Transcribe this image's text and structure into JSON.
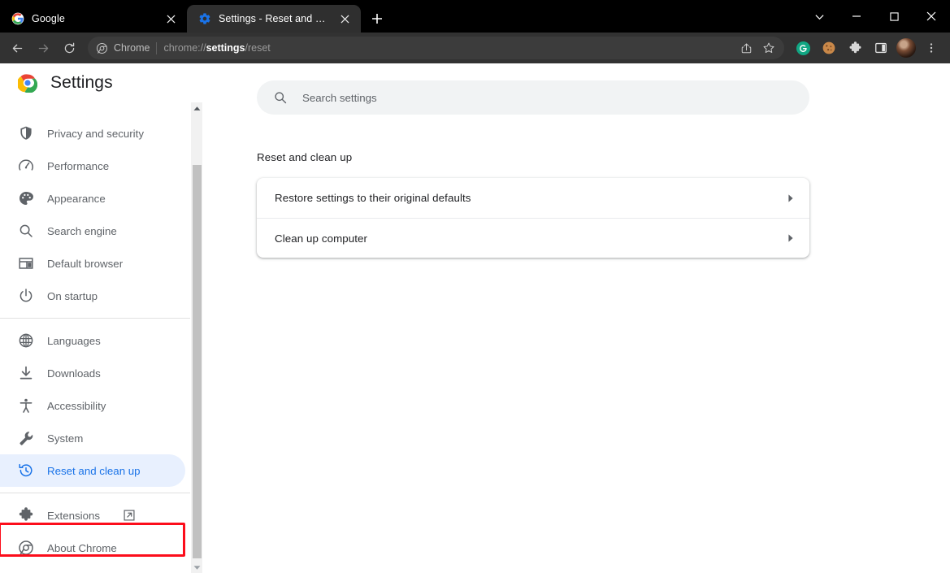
{
  "window": {
    "controls": [
      {
        "name": "tab-search-button",
        "icon": "chevron-down-icon",
        "label": "Search tabs"
      },
      {
        "name": "minimize-button",
        "icon": "minimize-icon",
        "label": "Minimize"
      },
      {
        "name": "maximize-button",
        "icon": "maximize-icon",
        "label": "Maximize"
      },
      {
        "name": "close-window-button",
        "icon": "close-icon",
        "label": "Close"
      }
    ]
  },
  "tabs": [
    {
      "title": "Google",
      "favicon": "google-favicon",
      "active": false,
      "close_label": "Close tab"
    },
    {
      "title": "Settings - Reset and clean up",
      "favicon": "settings-gear-favicon",
      "active": true,
      "close_label": "Close tab"
    }
  ],
  "new_tab_label": "New tab",
  "toolbar": {
    "back_label": "Back",
    "forward_label": "Forward",
    "reload_label": "Reload",
    "omnibox": {
      "chip_label": "Chrome",
      "url_prefix": "chrome://",
      "url_bold": "settings",
      "url_suffix": "/reset",
      "share_label": "Share this page",
      "bookmark_label": "Bookmark this tab"
    },
    "actions": [
      {
        "name": "grammarly-extension-icon",
        "label": "Grammarly",
        "color": "#11a683"
      },
      {
        "name": "cookie-extension-icon",
        "label": "Cookie manager",
        "color": "#c98849"
      },
      {
        "name": "extensions-icon",
        "label": "Extensions",
        "color": "#d7d7d7"
      },
      {
        "name": "side-panel-icon",
        "label": "Side panel",
        "color": "#e4e4e4"
      },
      {
        "name": "profile-avatar",
        "label": "Profile",
        "color": "#7a4d35"
      },
      {
        "name": "chrome-menu-icon",
        "label": "Customize and control Google Chrome",
        "color": "#d7d7d7"
      }
    ]
  },
  "settings": {
    "title": "Settings",
    "logo": "chrome-logo",
    "search": {
      "placeholder": "Search settings",
      "icon": "search-icon"
    },
    "nav_groups": [
      {
        "items": [
          {
            "label": "Privacy and security",
            "icon": "shield-icon",
            "selected": false
          },
          {
            "label": "Performance",
            "icon": "speedometer-icon",
            "selected": false
          },
          {
            "label": "Appearance",
            "icon": "palette-icon",
            "selected": false
          },
          {
            "label": "Search engine",
            "icon": "search-icon",
            "selected": false
          },
          {
            "label": "Default browser",
            "icon": "browser-window-icon",
            "selected": false
          },
          {
            "label": "On startup",
            "icon": "power-icon",
            "selected": false
          }
        ]
      },
      {
        "items": [
          {
            "label": "Languages",
            "icon": "globe-icon",
            "selected": false
          },
          {
            "label": "Downloads",
            "icon": "download-icon",
            "selected": false
          },
          {
            "label": "Accessibility",
            "icon": "accessibility-icon",
            "selected": false
          },
          {
            "label": "System",
            "icon": "wrench-icon",
            "selected": false
          },
          {
            "label": "Reset and clean up",
            "icon": "history-restore-icon",
            "selected": true
          }
        ]
      },
      {
        "items": [
          {
            "label": "Extensions",
            "icon": "puzzle-icon",
            "selected": false,
            "external": true
          },
          {
            "label": "About Chrome",
            "icon": "chrome-outline-icon",
            "selected": false
          }
        ]
      }
    ],
    "scrollbar": {
      "up_label": "Scroll up",
      "down_label": "Scroll down"
    }
  },
  "main": {
    "section_title": "Reset and clean up",
    "rows": [
      {
        "label": "Restore settings to their original defaults",
        "chevron": "chevron-right-icon"
      },
      {
        "label": "Clean up computer",
        "chevron": "chevron-right-icon"
      }
    ]
  },
  "annotation": {
    "highlight_color": "#fc0d1b",
    "target": "Reset and clean up"
  },
  "colors": {
    "accent": "#1a73e8",
    "selected_bg": "#e8f0fe",
    "text": "#202124",
    "muted_text": "#5f6368",
    "chrome_dark": "#323232",
    "tab_active": "#2f2f2f"
  }
}
